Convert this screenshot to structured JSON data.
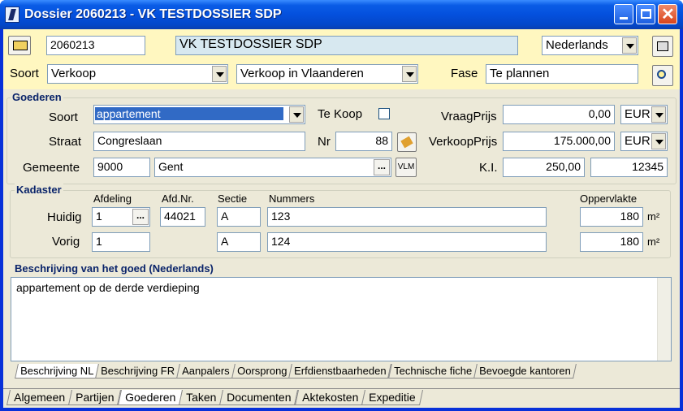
{
  "window": {
    "title": "Dossier 2060213 - VK TESTDOSSIER SDP"
  },
  "header": {
    "dossier_nr": "2060213",
    "dossier_name": "VK TESTDOSSIER SDP",
    "language": "Nederlands",
    "soort_label": "Soort",
    "soort": "Verkoop",
    "subsoort": "Verkoop in Vlaanderen",
    "fase_label": "Fase",
    "fase": "Te plannen"
  },
  "goederen": {
    "group": "Goederen",
    "soort_label": "Soort",
    "soort": "appartement",
    "tekoop_label": "Te Koop",
    "vraagprijs_label": "VraagPrijs",
    "vraagprijs": "0,00",
    "vraag_currency": "EUR",
    "straat_label": "Straat",
    "straat": "Congreslaan",
    "nr_label": "Nr",
    "nr": "88",
    "verkoopprijs_label": "VerkoopPrijs",
    "verkoopprijs": "175.000,00",
    "verkoop_currency": "EUR",
    "gemeente_label": "Gemeente",
    "postcode": "9000",
    "gemeente": "Gent",
    "dots": "...",
    "vlm": "VLM",
    "ki_label": "K.I.",
    "ki": "250,00",
    "ki2": "12345"
  },
  "kadaster": {
    "group": "Kadaster",
    "col_afdeling": "Afdeling",
    "col_afdnr": "Afd.Nr.",
    "col_sectie": "Sectie",
    "col_nummers": "Nummers",
    "col_opp": "Oppervlakte",
    "huidig_label": "Huidig",
    "vorig_label": "Vorig",
    "unit": "m²",
    "dots": "...",
    "huidig": {
      "afdeling": "1",
      "afdnr": "44021",
      "sectie": "A",
      "nummers": "123",
      "opp": "180"
    },
    "vorig": {
      "afdeling": "1",
      "sectie": "A",
      "nummers": "124",
      "opp": "180"
    }
  },
  "beschrijving": {
    "title": "Beschrijving van het goed (Nederlands)",
    "text": "appartement op de derde verdieping"
  },
  "inner_tabs": [
    "Beschrijving NL",
    "Beschrijving FR",
    "Aanpalers",
    "Oorsprong",
    "Erfdienstbaarheden",
    "Technische fiche",
    "Bevoegde kantoren"
  ],
  "main_tabs": [
    "Algemeen",
    "Partijen",
    "Goederen",
    "Taken",
    "Documenten",
    "Aktekosten",
    "Expeditie"
  ],
  "colors": {
    "title_blue": "#0450dd",
    "yellow_bar": "#fff7c0",
    "selection": "#316ac5"
  }
}
